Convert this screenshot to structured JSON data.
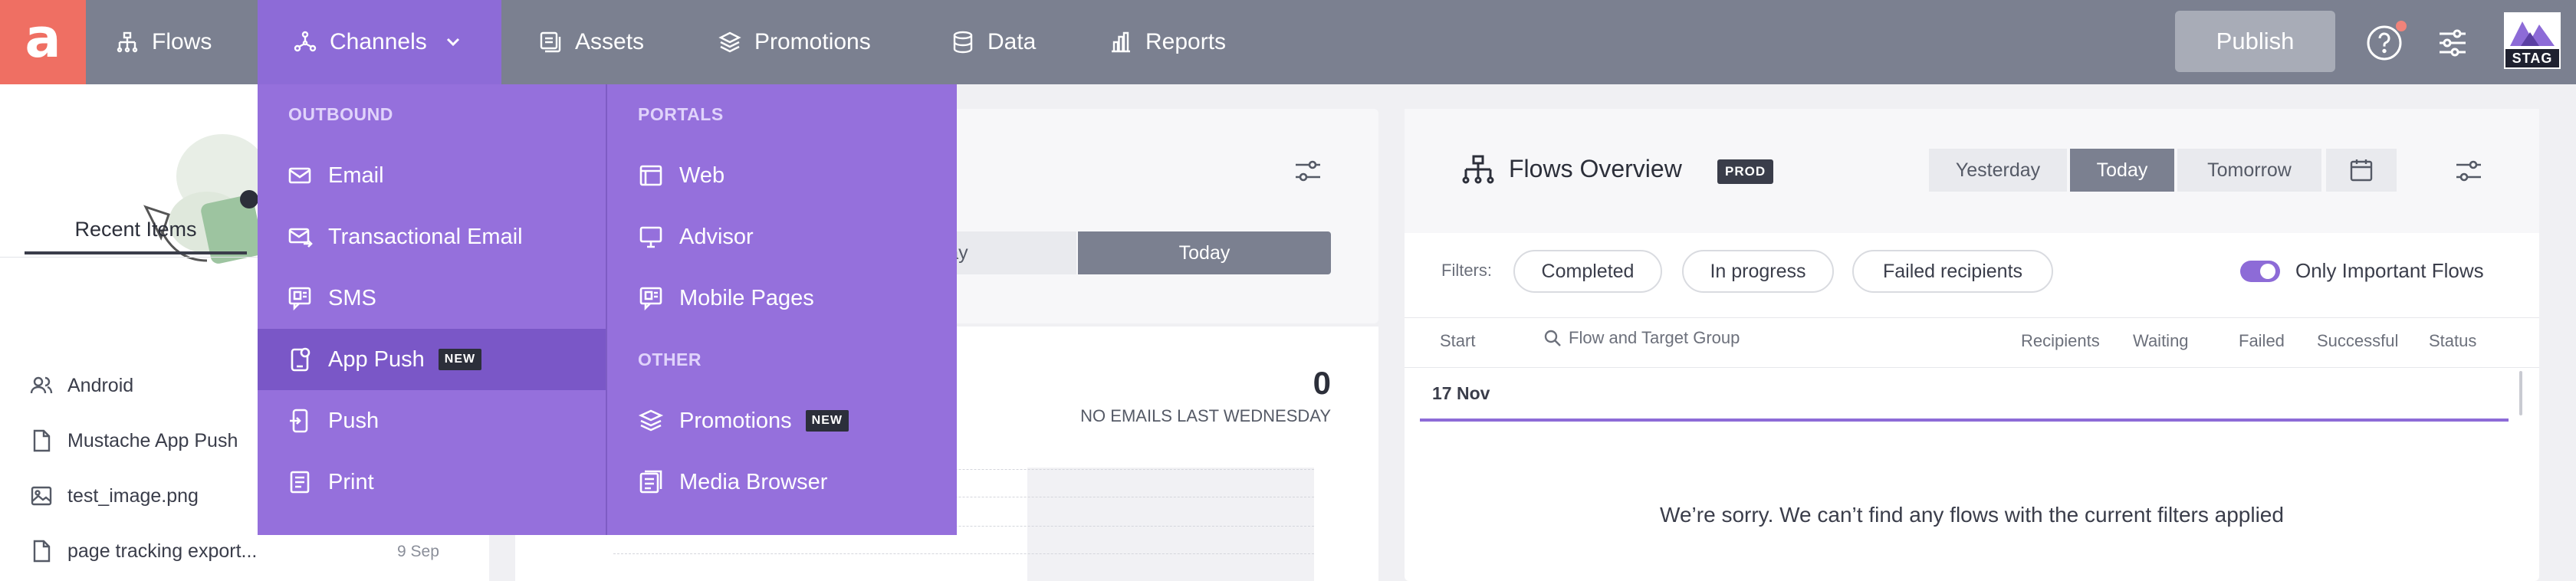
{
  "app": {
    "logo_letter": "a",
    "environment": "STAG"
  },
  "topnav": {
    "items": [
      {
        "label": "Flows",
        "icon": "flows-icon"
      },
      {
        "label": "Channels",
        "icon": "channels-icon",
        "active": true
      },
      {
        "label": "Assets",
        "icon": "assets-icon"
      },
      {
        "label": "Promotions",
        "icon": "promotions-icon"
      },
      {
        "label": "Data",
        "icon": "data-icon"
      },
      {
        "label": "Reports",
        "icon": "reports-icon"
      }
    ],
    "publish_label": "Publish"
  },
  "channels_menu": {
    "outbound_header": "OUTBOUND",
    "outbound": [
      {
        "label": "Email",
        "icon": "email-icon"
      },
      {
        "label": "Transactional Email",
        "icon": "transactional-email-icon"
      },
      {
        "label": "SMS",
        "icon": "sms-icon"
      },
      {
        "label": "App Push",
        "icon": "app-push-icon",
        "badge": "NEW",
        "selected": true
      },
      {
        "label": "Push",
        "icon": "push-icon"
      },
      {
        "label": "Print",
        "icon": "print-icon"
      }
    ],
    "portals_header": "PORTALS",
    "portals": [
      {
        "label": "Web",
        "icon": "web-icon"
      },
      {
        "label": "Advisor",
        "icon": "advisor-icon"
      },
      {
        "label": "Mobile Pages",
        "icon": "mobile-pages-icon"
      }
    ],
    "other_header": "OTHER",
    "other": [
      {
        "label": "Promotions",
        "icon": "promotions-icon",
        "badge": "NEW"
      },
      {
        "label": "Media Browser",
        "icon": "media-browser-icon"
      }
    ]
  },
  "left_panel": {
    "tab_label": "Recent Items",
    "items": [
      {
        "label": "Android",
        "icon": "users-icon"
      },
      {
        "label": "Mustache App Push",
        "icon": "document-icon"
      },
      {
        "label": "test_image.png",
        "icon": "image-icon"
      },
      {
        "label": "page tracking export...",
        "icon": "document-icon",
        "date": "9 Sep"
      }
    ]
  },
  "email_stats": {
    "segment_left": "rday",
    "segment_right": "Today",
    "count": "0",
    "label": "NO EMAILS LAST WEDNESDAY"
  },
  "flows_overview": {
    "title": "Flows Overview",
    "env_badge": "PROD",
    "days": [
      "Yesterday",
      "Today",
      "Tomorrow"
    ],
    "active_day": "Today",
    "filters_label": "Filters:",
    "filters": [
      "Completed",
      "In progress",
      "Failed recipients"
    ],
    "toggle_label": "Only Important Flows",
    "toggle_on": true,
    "columns": {
      "start": "Start",
      "flow": "Flow and Target Group",
      "recipients": "Recipients",
      "waiting": "Waiting",
      "failed": "Failed",
      "successful": "Successful",
      "status": "Status"
    },
    "date_row": "17 Nov",
    "empty_message": "We’re sorry. We can’t find any flows with the current filters applied"
  },
  "colors": {
    "topbar": "#7b8090",
    "logo": "#ef6f63",
    "menu": "#9570dc",
    "menu_selected": "#7a57c7",
    "accent": "#8d6bd7"
  }
}
